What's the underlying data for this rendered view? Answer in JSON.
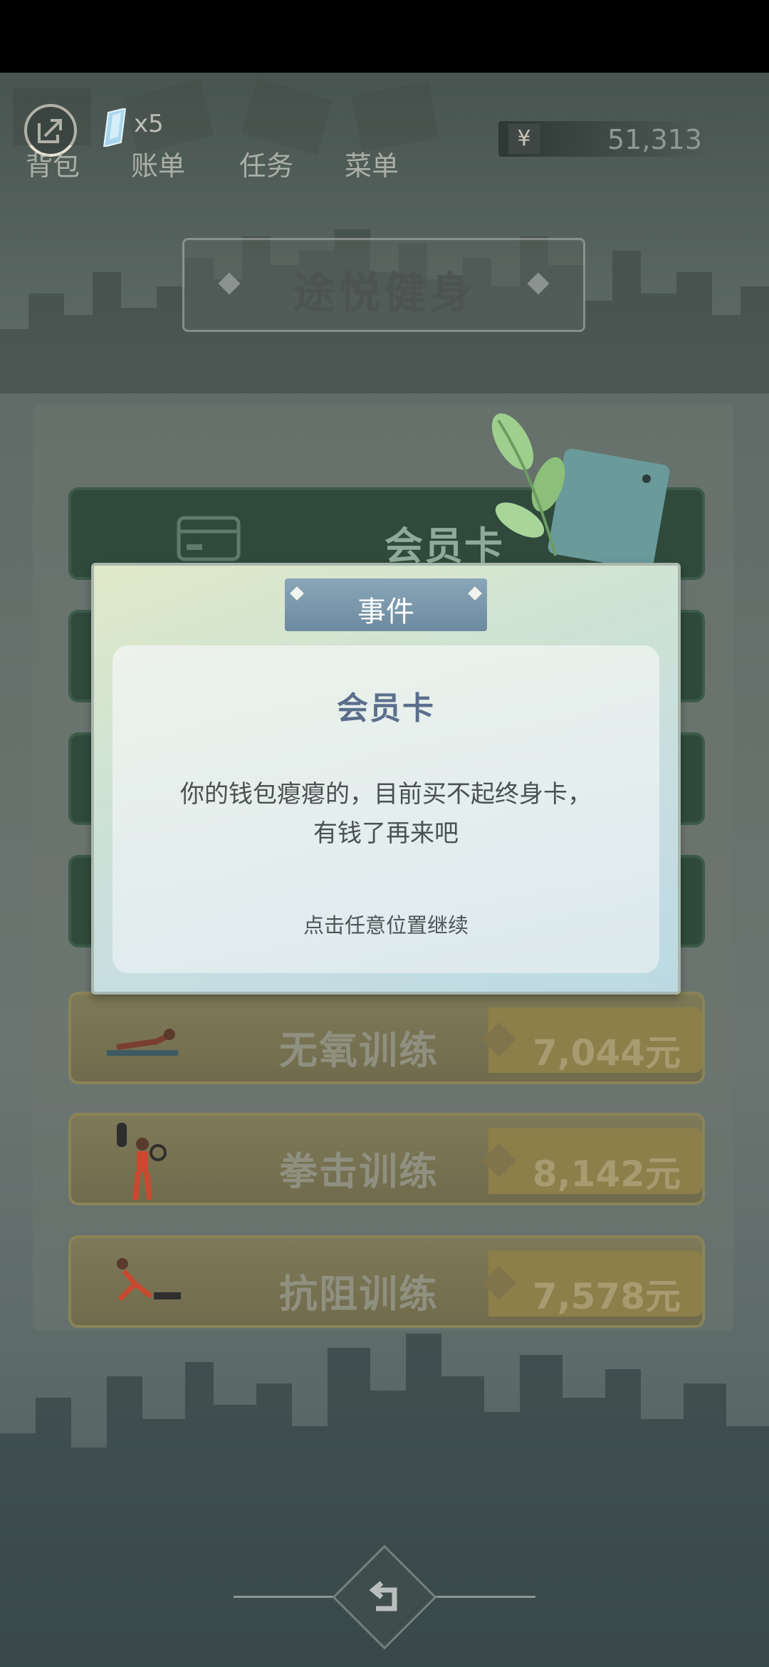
{
  "hud": {
    "crystal_count": "x5",
    "tabs": [
      {
        "label": "背包"
      },
      {
        "label": "账单"
      },
      {
        "label": "任务"
      },
      {
        "label": "菜单"
      }
    ],
    "currency_symbol": "¥",
    "money": "51,313"
  },
  "location": {
    "title": "途悦健身"
  },
  "options": [
    {
      "label": "会员卡",
      "style": "green",
      "icon": "card-icon"
    },
    {
      "label": "",
      "style": "green"
    },
    {
      "label": "",
      "style": "green"
    },
    {
      "label": "",
      "style": "green"
    },
    {
      "label": "无氧训练",
      "price": "7,044元",
      "icon": "plank-icon"
    },
    {
      "label": "拳击训练",
      "price": "8,142元",
      "icon": "boxing-icon"
    },
    {
      "label": "抗阻训练",
      "price": "7,578元",
      "icon": "resistance-icon"
    }
  ],
  "modal": {
    "tab_title": "事件",
    "card_title": "会员卡",
    "message_line1": "你的钱包瘪瘪的，目前买不起终身卡，",
    "message_line2": "有钱了再来吧",
    "hint": "点击任意位置继续"
  },
  "colors": {
    "status_bar": "#000000",
    "modal_title": "#5b6e8c",
    "event_tab": "#7b97ac"
  }
}
